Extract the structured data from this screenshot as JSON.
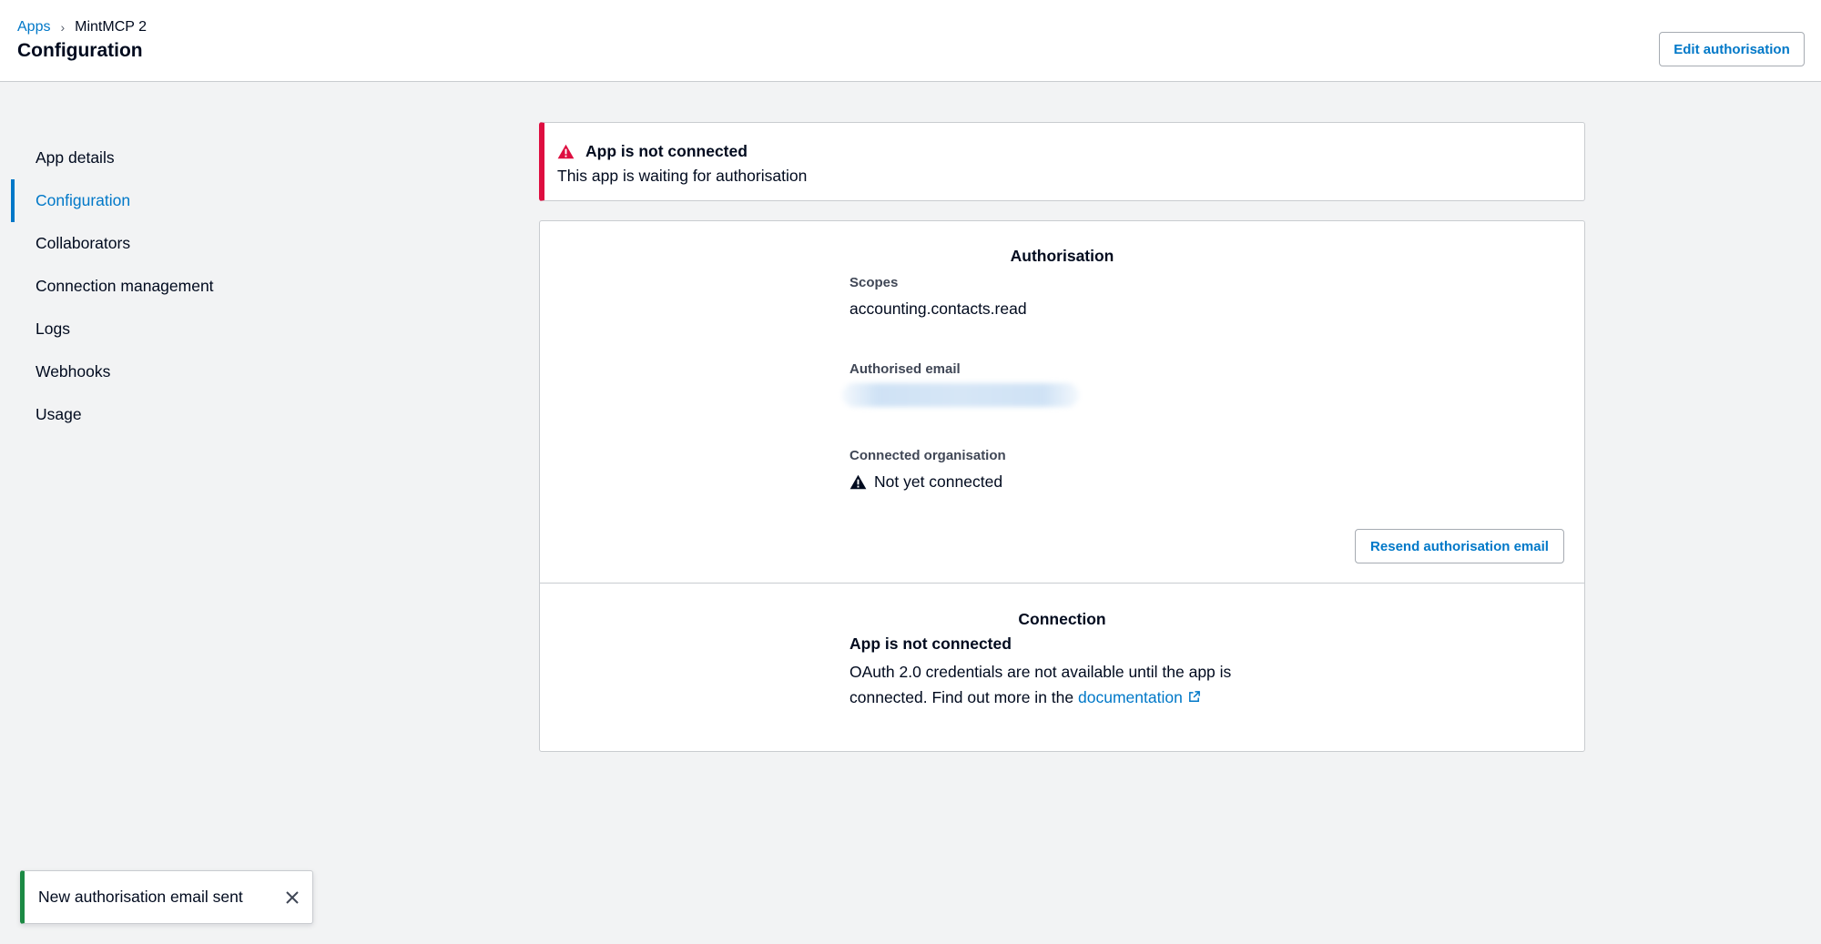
{
  "header": {
    "breadcrumb": {
      "parent": "Apps",
      "current": "MintMCP 2"
    },
    "title": "Configuration",
    "edit_label": "Edit authorisation"
  },
  "sidebar": {
    "items": [
      {
        "label": "App details",
        "active": false
      },
      {
        "label": "Configuration",
        "active": true
      },
      {
        "label": "Collaborators",
        "active": false
      },
      {
        "label": "Connection management",
        "active": false
      },
      {
        "label": "Logs",
        "active": false
      },
      {
        "label": "Webhooks",
        "active": false
      },
      {
        "label": "Usage",
        "active": false
      }
    ]
  },
  "alert": {
    "title": "App is not connected",
    "text": "This app is waiting for authorisation",
    "icon": "warning-icon",
    "color": "#de0e40"
  },
  "authorisation": {
    "title": "Authorisation",
    "scopes_label": "Scopes",
    "scopes_value": "accounting.contacts.read",
    "email_label": "Authorised email",
    "org_label": "Connected organisation",
    "org_value": "Not yet connected",
    "resend_label": "Resend authorisation email"
  },
  "connection": {
    "title": "Connection",
    "status": "App is not connected",
    "text": "OAuth 2.0 credentials are not available until the app is connected. Find out more in the",
    "link_label": "documentation"
  },
  "toast": {
    "text": "New authorisation email sent",
    "accent_color": "#1c8a44"
  },
  "colors": {
    "link": "#0078c8",
    "danger": "#de0e40",
    "background": "#f2f3f4"
  }
}
